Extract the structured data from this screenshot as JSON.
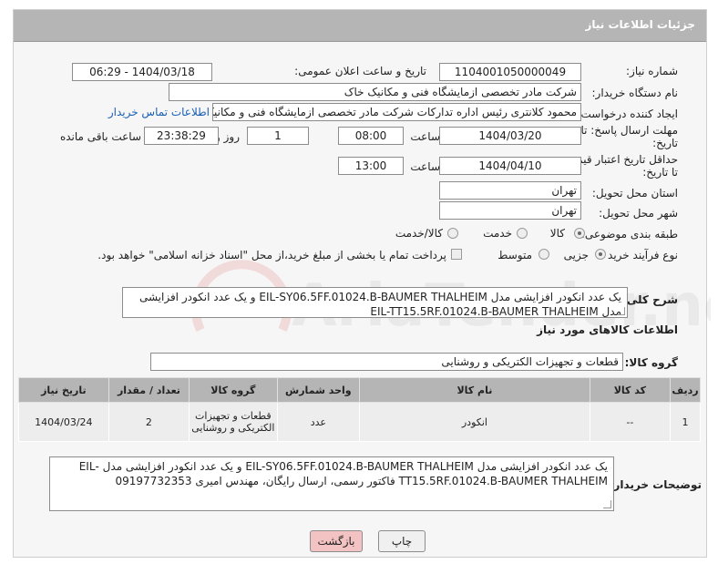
{
  "header": {
    "title": "جزئیات اطلاعات نیاز"
  },
  "fields": {
    "need_number_label": "شماره نیاز:",
    "need_number": "1104001050000049",
    "announce_label": "تاریخ و ساعت اعلان عمومی:",
    "announce_value": "1404/03/18 - 06:29",
    "buyer_org_label": "نام دستگاه خریدار:",
    "buyer_org": "شرکت مادر تخصصی ازمایشگاه فنی و مکانیک خاک",
    "creator_label": "ایجاد کننده درخواست:",
    "creator": "محمود کلانتری رئیس اداره تدارکات شرکت مادر تخصصی ازمایشگاه فنی و مکانیک",
    "contact_link": "اطلاعات تماس خریدار",
    "deadline_label_1": "مهلت ارسال پاسخ: تا",
    "deadline_label_2": "تاریخ:",
    "deadline_date": "1404/03/20",
    "hour_label": "ساعت",
    "deadline_time": "08:00",
    "days_value": "1",
    "days_label": "روز و",
    "remaining_time": "23:38:29",
    "remaining_label": "ساعت باقی مانده",
    "validity_label_1": "حداقل تاریخ اعتبار قیمت:",
    "validity_label_2": "تا تاریخ:",
    "validity_date": "1404/04/10",
    "validity_time": "13:00",
    "province_label": "استان محل تحویل:",
    "province": "تهران",
    "city_label": "شهر محل تحویل:",
    "city": "تهران",
    "category_label": "طبقه بندی موضوعی:",
    "category_options": [
      "کالا",
      "خدمت",
      "کالا/خدمت"
    ],
    "process_label": "نوع فرآیند خرید :",
    "process_options": [
      "جزیی",
      "متوسط"
    ],
    "payment_note": "پرداخت تمام یا بخشی از مبلغ خرید،از محل \"اسناد خزانه اسلامی\" خواهد بود."
  },
  "description": {
    "label": "شرح کلی نیاز:",
    "text": "یک عدد انکودر افزایشی مدل EIL-SY06.5FF.01024.B-BAUMER THALHEIM و یک عدد انکودر افزایشی مدل EIL-TT15.5RF.01024.B-BAUMER THALHEIM"
  },
  "goods_section": {
    "title": "اطلاعات کالاهای مورد نیاز",
    "group_label": "گروه کالا:",
    "group_value": "قطعات و تجهیزات الکتریکی و روشنایی"
  },
  "table": {
    "headers": [
      "ردیف",
      "کد کالا",
      "نام کالا",
      "واحد شمارش",
      "گروه کالا",
      "تعداد / مقدار",
      "تاریخ نیاز"
    ],
    "rows": [
      [
        "1",
        "--",
        "انکودر",
        "عدد",
        "قطعات و تجهیزات الکتریکی و روشنایی",
        "2",
        "1404/03/24"
      ]
    ]
  },
  "buyer_notes": {
    "label": "توضیحات خریدار:",
    "text": "یک عدد انکودر افزایشی مدل EIL-SY06.5FF.01024.B-BAUMER THALHEIM و یک عدد انکودر افزایشی مدل -EIL TT15.5RF.01024.B-BAUMER THALHEIM فاکتور رسمی، ارسال رایگان، مهندس امیری 09197732353"
  },
  "buttons": {
    "print": "چاپ",
    "back": "بازگشت"
  },
  "watermark": {
    "text": "AriaTender.neT"
  },
  "colors": {
    "header_bg": "#b5b5b5",
    "back_button_bg": "#f3c2c2",
    "link": "#1a5fb4"
  }
}
